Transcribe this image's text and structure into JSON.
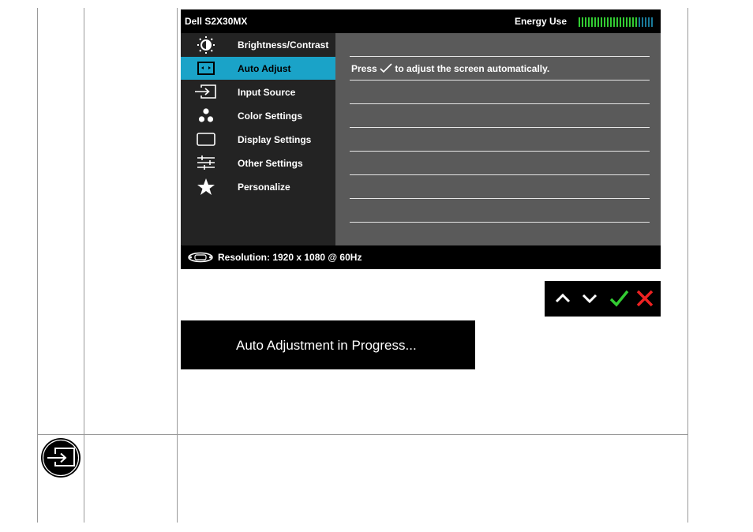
{
  "osd": {
    "model": "Dell S2X30MX",
    "energy_label": "Energy Use",
    "energy_level": 0.8,
    "menu": [
      {
        "label": "Brightness/Contrast",
        "icon": "brightness-contrast-icon",
        "selected": false
      },
      {
        "label": "Auto Adjust",
        "icon": "auto-adjust-icon",
        "selected": true
      },
      {
        "label": "Input Source",
        "icon": "input-source-icon",
        "selected": false
      },
      {
        "label": "Color Settings",
        "icon": "color-settings-icon",
        "selected": false
      },
      {
        "label": "Display Settings",
        "icon": "display-settings-icon",
        "selected": false
      },
      {
        "label": "Other Settings",
        "icon": "other-settings-icon",
        "selected": false
      },
      {
        "label": "Personalize",
        "icon": "star-icon",
        "selected": false
      }
    ],
    "panel": {
      "message_before": "Press",
      "message_after": "to adjust the screen automatically."
    },
    "status": {
      "resolution": "Resolution: 1920 x 1080 @ 60Hz"
    },
    "colors": {
      "selected": "#1aa3c8",
      "menu_bg": "#232323",
      "panel_bg": "#5a5a5a",
      "energy_on": "#33cc33",
      "energy_off": "#1a7a9a"
    }
  },
  "front_buttons": [
    "up-arrow-icon",
    "down-arrow-icon",
    "check-icon",
    "close-icon"
  ],
  "progress": {
    "message": "Auto Adjustment in Progress..."
  }
}
